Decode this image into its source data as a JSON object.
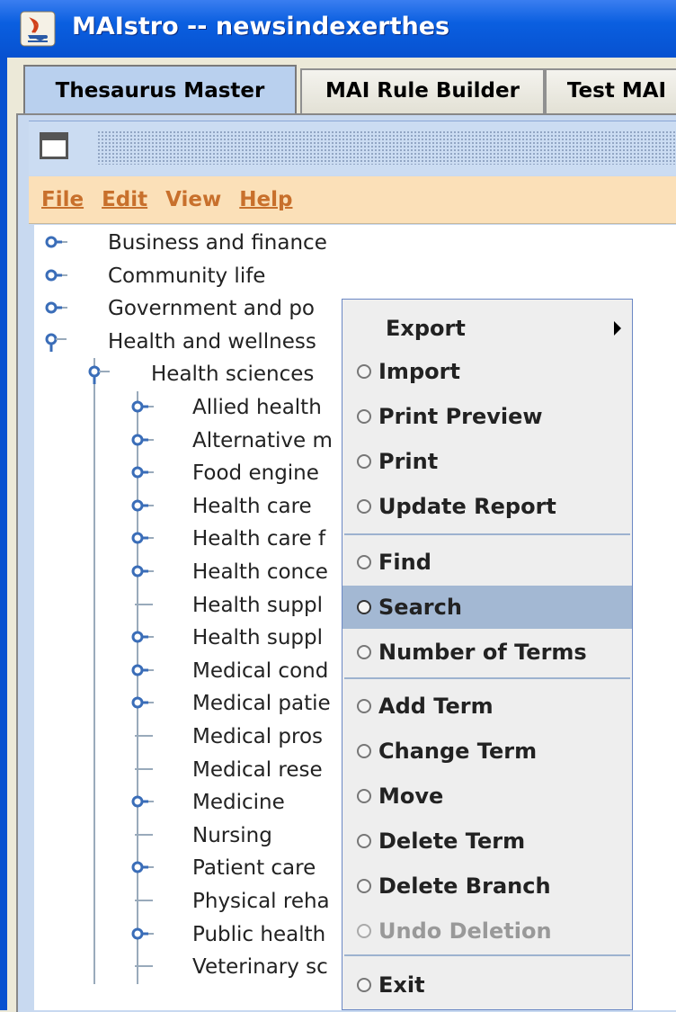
{
  "window": {
    "title": "MAIstro -- newsindexerthes"
  },
  "tabs": [
    {
      "label": "Thesaurus Master",
      "active": true
    },
    {
      "label": "MAI Rule Builder",
      "active": false
    },
    {
      "label": "Test MAI",
      "active": false
    }
  ],
  "menubar": {
    "file": "File",
    "edit": "Edit",
    "view": "View",
    "help": "Help"
  },
  "tree": {
    "items": [
      {
        "label": "Business and finance",
        "icon": "key-icon"
      },
      {
        "label": "Community life",
        "icon": "key-icon"
      },
      {
        "label": "Government and po",
        "icon": "key-icon"
      },
      {
        "label": "Health and wellness",
        "icon": "key-open-icon"
      },
      {
        "label": "Health sciences",
        "icon": "key-open-icon"
      },
      {
        "label": "Allied health",
        "icon": "key-icon"
      },
      {
        "label": "Alternative m",
        "icon": "key-icon"
      },
      {
        "label": "Food engine",
        "icon": "key-icon"
      },
      {
        "label": "Health care",
        "icon": "key-icon"
      },
      {
        "label": "Health care f",
        "icon": "key-icon"
      },
      {
        "label": "Health conce",
        "icon": "key-icon"
      },
      {
        "label": "Health suppl",
        "icon": "leaf-line"
      },
      {
        "label": "Health suppl",
        "icon": "key-icon"
      },
      {
        "label": "Medical cond",
        "icon": "key-icon"
      },
      {
        "label": "Medical patie",
        "icon": "key-icon"
      },
      {
        "label": "Medical pros",
        "icon": "leaf-line"
      },
      {
        "label": "Medical rese",
        "icon": "leaf-line"
      },
      {
        "label": "Medicine",
        "icon": "key-icon"
      },
      {
        "label": "Nursing",
        "icon": "leaf-line"
      },
      {
        "label": "Patient care",
        "icon": "key-icon"
      },
      {
        "label": "Physical reha",
        "icon": "leaf-line"
      },
      {
        "label": "Public health",
        "icon": "key-icon"
      },
      {
        "label": "Veterinary sc",
        "icon": "leaf-line"
      }
    ]
  },
  "popup": {
    "items": [
      {
        "label": "Export",
        "has_submenu": true
      },
      {
        "label": "Import"
      },
      {
        "label": "Print Preview"
      },
      {
        "label": "Print"
      },
      {
        "label": "Update Report"
      },
      {
        "label": "Find"
      },
      {
        "label": "Search",
        "selected": true
      },
      {
        "label": "Number of Terms"
      },
      {
        "label": "Add Term"
      },
      {
        "label": "Change Term"
      },
      {
        "label": "Move"
      },
      {
        "label": "Delete Term"
      },
      {
        "label": "Delete Branch"
      },
      {
        "label": "Undo Deletion",
        "disabled": true
      },
      {
        "label": "Exit"
      }
    ]
  }
}
